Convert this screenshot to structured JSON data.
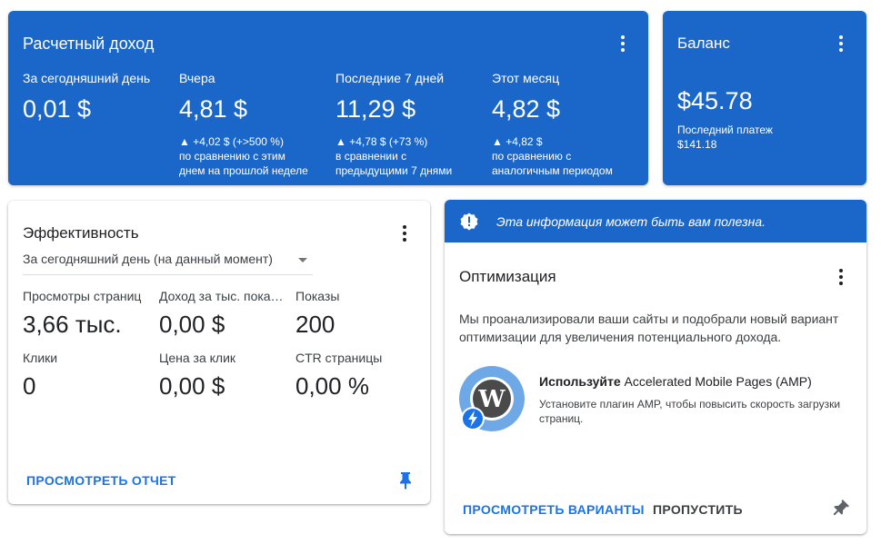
{
  "earnings": {
    "title": "Расчетный доход",
    "periods": [
      {
        "label": "За сегодняшний день",
        "value": "0,01 $",
        "delta": "",
        "comparison_line1": "",
        "comparison_line2": ""
      },
      {
        "label": "Вчера",
        "value": "4,81 $",
        "delta": "▲ +4,02 $ (+>500 %)",
        "comparison_line1": "по сравнению с этим",
        "comparison_line2": "днем на прошлой неделе"
      },
      {
        "label": "Последние 7 дней",
        "value": "11,29 $",
        "delta": "▲ +4,78 $ (+73 %)",
        "comparison_line1": "в сравнении с",
        "comparison_line2": "предыдущими 7 днями"
      },
      {
        "label": "Этот месяц",
        "value": "4,82 $",
        "delta": "▲ +4,82 $",
        "comparison_line1": "по сравнению с",
        "comparison_line2": "аналогичным периодом"
      }
    ]
  },
  "balance": {
    "title": "Баланс",
    "amount": "$45.78",
    "last_payment_label": "Последний платеж",
    "last_payment_amount": "$141.18"
  },
  "performance": {
    "title": "Эффективность",
    "range_selected": "За сегодняшний день (на данный момент)",
    "metrics": [
      {
        "label": "Просмотры страниц",
        "value": "3,66 тыс."
      },
      {
        "label": "Доход за тыс. показов",
        "value": "0,00 $"
      },
      {
        "label": "Показы",
        "value": "200"
      },
      {
        "label": "Клики",
        "value": "0"
      },
      {
        "label": "Цена за клик",
        "value": "0,00 $"
      },
      {
        "label": "CTR страницы",
        "value": "0,00 %"
      }
    ],
    "report_link": "ПРОСМОТРЕТЬ ОТЧЕТ"
  },
  "optimization": {
    "banner_text": "Эта информация может быть вам полезна.",
    "title": "Оптимизация",
    "description": "Мы проанализировали ваши сайты и подобрали новый вариант оптимизации для увеличения потенциального дохода.",
    "suggestion_bold": "Используйте",
    "suggestion_rest": " Accelerated Mobile Pages (AMP)",
    "suggestion_desc": "Установите плагин AMP, чтобы повысить скорость загрузки страниц.",
    "view_options": "ПРОСМОТРЕТЬ ВАРИАНТЫ",
    "skip": "ПРОПУСТИТЬ"
  },
  "colors": {
    "brand_blue": "#1a67c9",
    "link_blue": "#1a73e8"
  }
}
